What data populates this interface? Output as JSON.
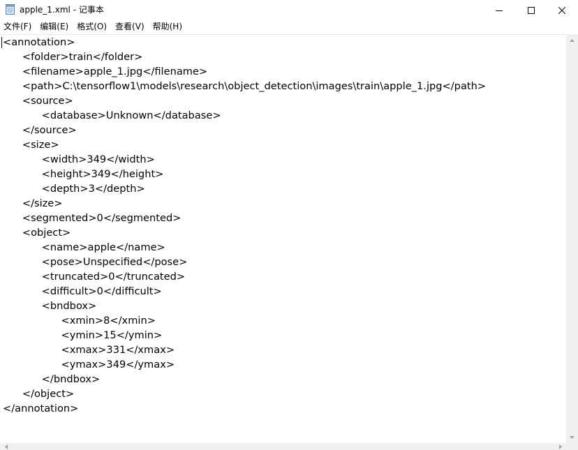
{
  "window": {
    "title": "apple_1.xml - 记事本",
    "app_icon": "notepad-icon",
    "controls": {
      "minimize_icon": "minimize-icon",
      "maximize_icon": "maximize-icon",
      "close_icon": "close-icon"
    }
  },
  "menu": {
    "items": [
      {
        "label": "文件(F)"
      },
      {
        "label": "编辑(E)"
      },
      {
        "label": "格式(O)"
      },
      {
        "label": "查看(V)"
      },
      {
        "label": "帮助(H)"
      }
    ]
  },
  "editor": {
    "content": "<annotation>\n\t<folder>train</folder>\n\t<filename>apple_1.jpg</filename>\n\t<path>C:\\tensorflow1\\models\\research\\object_detection\\images\\train\\apple_1.jpg</path>\n\t<source>\n\t\t<database>Unknown</database>\n\t</source>\n\t<size>\n\t\t<width>349</width>\n\t\t<height>349</height>\n\t\t<depth>3</depth>\n\t</size>\n\t<segmented>0</segmented>\n\t<object>\n\t\t<name>apple</name>\n\t\t<pose>Unspecified</pose>\n\t\t<truncated>0</truncated>\n\t\t<difficult>0</difficult>\n\t\t<bndbox>\n\t\t\t<xmin>8</xmin>\n\t\t\t<ymin>15</ymin>\n\t\t\t<xmax>331</xmax>\n\t\t\t<ymax>349</ymax>\n\t\t</bndbox>\n\t</object>\n</annotation>"
  },
  "scrollbars": {
    "up_icon": "scroll-up-arrow-icon",
    "down_icon": "scroll-down-arrow-icon",
    "left_icon": "scroll-left-arrow-icon",
    "right_icon": "scroll-right-arrow-icon"
  },
  "colors": {
    "background": "#ffffff",
    "text": "#000000",
    "scrollbar": "#f0f0f0"
  }
}
